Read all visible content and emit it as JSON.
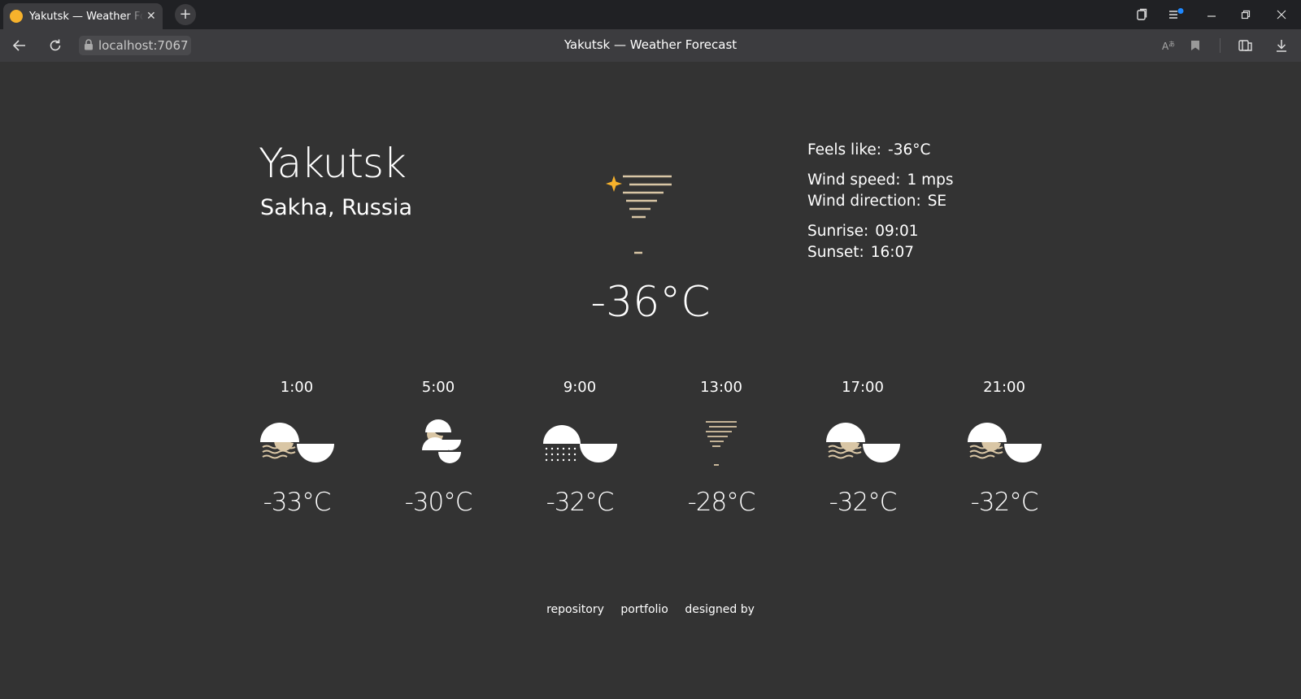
{
  "browser": {
    "tab_title": "Yakutsk — Weather Forecast",
    "url": "localhost:7067",
    "page_title": "Yakutsk — Weather Forecast"
  },
  "location": {
    "city": "Yakutsk",
    "region": "Sakha, Russia"
  },
  "current": {
    "icon": "sun-haze-icon",
    "temperature": "-36°C",
    "feels_like_label": "Feels like:",
    "feels_like": "-36°C",
    "wind_speed_label": "Wind speed:",
    "wind_speed": "1 mps",
    "wind_direction_label": "Wind direction:",
    "wind_direction": "SE",
    "sunrise_label": "Sunrise:",
    "sunrise": "09:01",
    "sunset_label": "Sunset:",
    "sunset": "16:07"
  },
  "hourly": [
    {
      "time": "1:00",
      "temp": "-33°C",
      "icon": "moon-fog-cloud-icon"
    },
    {
      "time": "5:00",
      "temp": "-30°C",
      "icon": "moon-cloud-icon"
    },
    {
      "time": "9:00",
      "temp": "-32°C",
      "icon": "snow-cloud-icon"
    },
    {
      "time": "13:00",
      "temp": "-28°C",
      "icon": "haze-icon"
    },
    {
      "time": "17:00",
      "temp": "-32°C",
      "icon": "moon-fog-cloud-icon"
    },
    {
      "time": "21:00",
      "temp": "-32°C",
      "icon": "moon-fog-cloud-icon"
    }
  ],
  "footer": {
    "links": [
      "repository",
      "portfolio",
      "designed by"
    ]
  },
  "colors": {
    "background": "#333333",
    "accent": "#f7b22c",
    "icon_beige": "#d9c6a5"
  }
}
